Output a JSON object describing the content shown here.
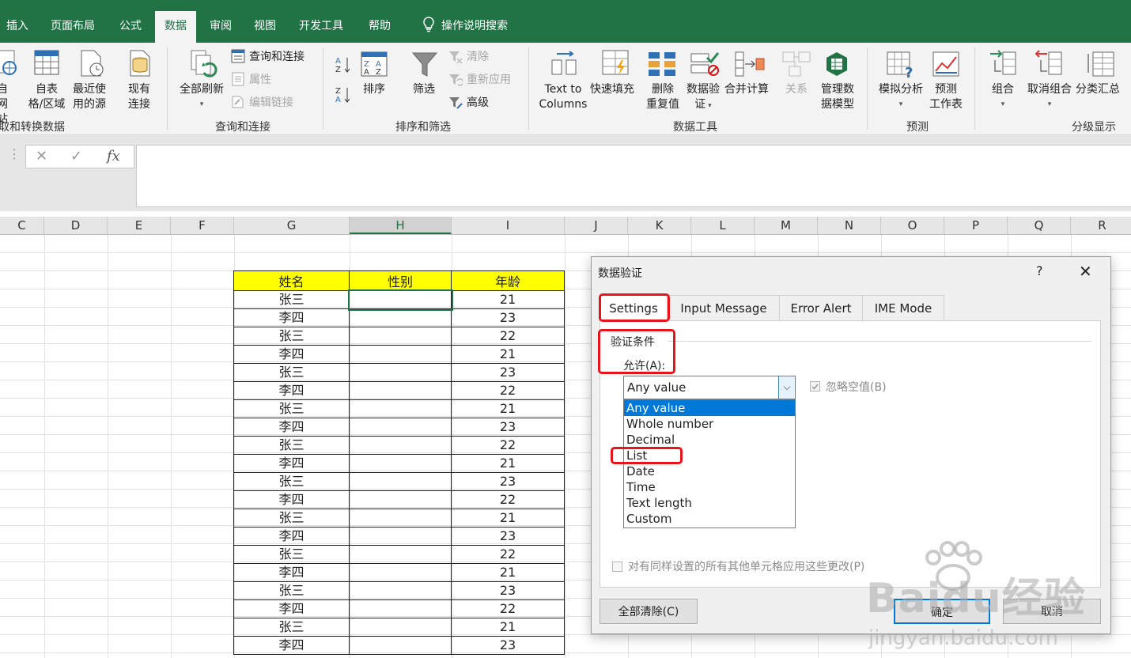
{
  "tabs": [
    "插入",
    "页面布局",
    "公式",
    "数据",
    "审阅",
    "视图",
    "开发工具",
    "帮助",
    "操作说明搜索"
  ],
  "active_tab": "数据",
  "ribbon": {
    "get_data": {
      "web_line1": "自",
      "web_line2": "网站",
      "table_line1": "自表",
      "table_line2": "格/区域",
      "recent_line1": "最近使",
      "recent_line2": "用的源",
      "existing_line1": "现有",
      "existing_line2": "连接",
      "label": "取和转换数据"
    },
    "queries": {
      "refresh_all": "全部刷新",
      "queries_connections": "查询和连接",
      "properties": "属性",
      "edit_links": "编辑链接",
      "label": "查询和连接"
    },
    "sort_filter": {
      "sort": "排序",
      "filter": "筛选",
      "clear": "清除",
      "reapply": "重新应用",
      "advanced": "高级",
      "label": "排序和筛选"
    },
    "data_tools": {
      "text_to_columns_1": "Text to",
      "text_to_columns_2": "Columns",
      "flash_fill": "快速填充",
      "remove_dup_1": "删除",
      "remove_dup_2": "重复值",
      "validation_1": "数据验",
      "validation_2": "证",
      "consolidate": "合并计算",
      "relations": "关系",
      "data_model_1": "管理数",
      "data_model_2": "据模型",
      "label": "数据工具"
    },
    "forecast": {
      "what_if": "模拟分析",
      "sheet_1": "预测",
      "sheet_2": "工作表",
      "label": "预测"
    },
    "outline": {
      "group": "组合",
      "ungroup": "取消组合",
      "subtotal": "分类汇总",
      "label": "分级显示"
    }
  },
  "formula_bar": {
    "cancel": "✕",
    "enter": "✓",
    "fx": "fx"
  },
  "columns": [
    "C",
    "D",
    "E",
    "F",
    "G",
    "H",
    "I",
    "J",
    "K",
    "L",
    "M",
    "N",
    "O",
    "P",
    "Q",
    "R"
  ],
  "table": {
    "headers": [
      "姓名",
      "性别",
      "年龄"
    ],
    "rows": [
      [
        "张三",
        "",
        "21"
      ],
      [
        "李四",
        "",
        "23"
      ],
      [
        "张三",
        "",
        "22"
      ],
      [
        "李四",
        "",
        "21"
      ],
      [
        "张三",
        "",
        "23"
      ],
      [
        "李四",
        "",
        "22"
      ],
      [
        "张三",
        "",
        "21"
      ],
      [
        "李四",
        "",
        "23"
      ],
      [
        "张三",
        "",
        "22"
      ],
      [
        "李四",
        "",
        "21"
      ],
      [
        "张三",
        "",
        "23"
      ],
      [
        "李四",
        "",
        "22"
      ],
      [
        "张三",
        "",
        "21"
      ],
      [
        "李四",
        "",
        "23"
      ],
      [
        "张三",
        "",
        "22"
      ],
      [
        "李四",
        "",
        "21"
      ],
      [
        "张三",
        "",
        "23"
      ],
      [
        "李四",
        "",
        "22"
      ],
      [
        "张三",
        "",
        "21"
      ],
      [
        "李四",
        "",
        "23"
      ]
    ]
  },
  "dialog": {
    "title": "数据验证",
    "help": "?",
    "close": "✕",
    "tabs": [
      "Settings",
      "Input Message",
      "Error Alert",
      "IME Mode"
    ],
    "section": "验证条件",
    "allow_label": "允许(A):",
    "allow_value": "Any value",
    "ignore_blank": "忽略空值(B)",
    "options": [
      "Any value",
      "Whole number",
      "Decimal",
      "List",
      "Date",
      "Time",
      "Text length",
      "Custom"
    ],
    "apply_all": "对有同样设置的所有其他单元格应用这些更改(P)",
    "clear_all": "全部清除(C)",
    "ok": "确定",
    "cancel": "取消"
  },
  "watermark": {
    "main": "Baidu经验",
    "sub": "jingyan.baidu.com"
  }
}
